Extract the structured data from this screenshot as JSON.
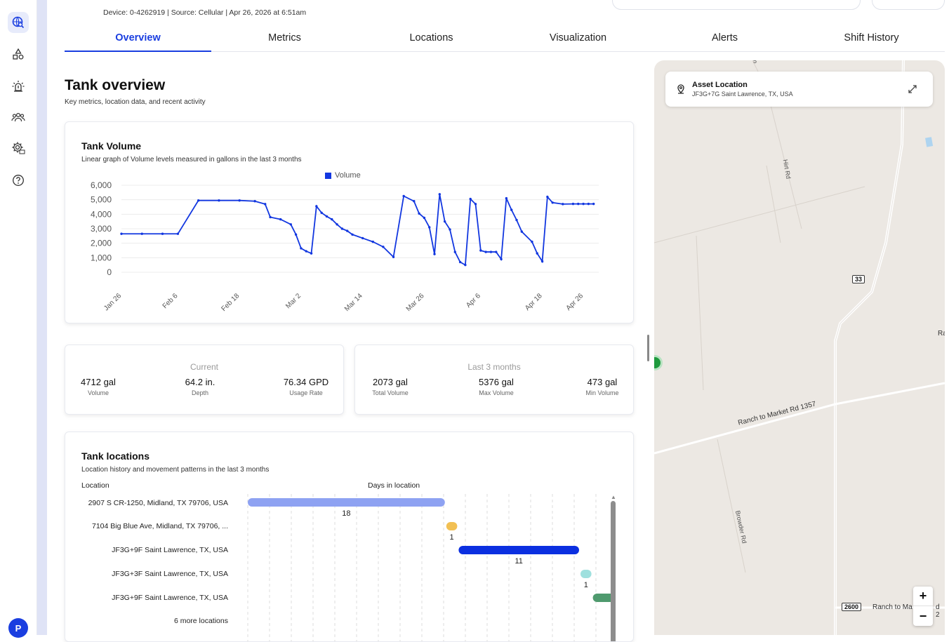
{
  "header": {
    "device_line": "Device: 0-4262919  |  Source: Cellular  |  Apr 26, 2026 at 6:51am"
  },
  "tabs": [
    "Overview",
    "Metrics",
    "Locations",
    "Visualization",
    "Alerts",
    "Shift History"
  ],
  "page": {
    "title": "Tank overview",
    "subtitle": "Key metrics, location data, and recent activity"
  },
  "volume_card": {
    "title": "Tank Volume",
    "subtitle": "Linear graph of Volume levels measured in gallons in the last 3 months",
    "legend": "Volume"
  },
  "chart_data": {
    "type": "line",
    "title": "Tank Volume",
    "ylim": [
      0,
      6000
    ],
    "y_ticks": [
      "6,000",
      "5,000",
      "4,000",
      "3,000",
      "2,000",
      "1,000",
      "0"
    ],
    "x_ticks": [
      "Jan 26",
      "Feb 6",
      "Feb 18",
      "Mar 2",
      "Mar 14",
      "Mar 26",
      "Apr 6",
      "Apr 18",
      "Apr 26"
    ],
    "x_range": [
      "Jan 26",
      "Apr 29"
    ],
    "series": [
      {
        "name": "Volume",
        "color": "#1237e0",
        "x": [
          "Jan 26",
          "Jan 30",
          "Feb 3",
          "Feb 6",
          "Feb 10",
          "Feb 14",
          "Feb 18",
          "Feb 21",
          "Feb 23",
          "Feb 24",
          "Feb 26",
          "Feb 28",
          "Mar 1",
          "Mar 2",
          "Mar 3",
          "Mar 4",
          "Mar 5",
          "Mar 6",
          "Mar 7",
          "Mar 8",
          "Mar 9",
          "Mar 10",
          "Mar 11",
          "Mar 12",
          "Mar 14",
          "Mar 16",
          "Mar 18",
          "Mar 20",
          "Mar 22",
          "Mar 24",
          "Mar 25",
          "Mar 26",
          "Mar 27",
          "Mar 28",
          "Mar 29",
          "Mar 30",
          "Mar 31",
          "Apr 1",
          "Apr 2",
          "Apr 3",
          "Apr 4",
          "Apr 5",
          "Apr 6",
          "Apr 7",
          "Apr 8",
          "Apr 9",
          "Apr 10",
          "Apr 11",
          "Apr 12",
          "Apr 13",
          "Apr 14",
          "Apr 16",
          "Apr 17",
          "Apr 18",
          "Apr 19",
          "Apr 20",
          "Apr 22",
          "Apr 24",
          "Apr 25",
          "Apr 26",
          "Apr 27",
          "Apr 28"
        ],
        "values": [
          2650,
          2650,
          2650,
          2650,
          4950,
          4950,
          4950,
          4900,
          4700,
          3800,
          3650,
          3300,
          2600,
          1650,
          1450,
          1300,
          4550,
          4100,
          3850,
          3650,
          3300,
          3000,
          2850,
          2600,
          2350,
          2100,
          1750,
          1050,
          5250,
          4900,
          4050,
          3750,
          3100,
          1250,
          5380,
          3500,
          2950,
          1400,
          700,
          500,
          5050,
          4700,
          1500,
          1400,
          1400,
          1400,
          900,
          5100,
          4300,
          3600,
          2800,
          2100,
          1300,
          750,
          5200,
          4800,
          4700,
          4712,
          4712,
          4712,
          4712,
          4712
        ]
      }
    ]
  },
  "current_card": {
    "heading": "Current",
    "stats": [
      {
        "value": "4712 gal",
        "label": "Volume"
      },
      {
        "value": "64.2 in.",
        "label": "Depth"
      },
      {
        "value": "76.34 GPD",
        "label": "Usage Rate"
      }
    ]
  },
  "last3_card": {
    "heading": "Last 3 months",
    "stats": [
      {
        "value": "2073 gal",
        "label": "Total Volume"
      },
      {
        "value": "5376 gal",
        "label": "Max Volume"
      },
      {
        "value": "473 gal",
        "label": "Min Volume"
      }
    ]
  },
  "locations_card": {
    "title": "Tank locations",
    "subtitle": "Location history and movement patterns in the last 3 months",
    "col_location": "Location",
    "col_days": "Days in location",
    "rows": [
      {
        "name": "2907 S CR-1250, Midland, TX 79706, USA",
        "days": 18,
        "days_label": "18",
        "color": "#8ea2f2"
      },
      {
        "name": "7104 Big Blue Ave, Midland, TX 79706, ...",
        "days": 1,
        "days_label": "1",
        "color": "#f2c053"
      },
      {
        "name": "JF3G+9F Saint Lawrence, TX, USA",
        "days": 11,
        "days_label": "11",
        "color": "#0b2fe0"
      },
      {
        "name": "JF3G+3F Saint Lawrence, TX, USA",
        "days": 1,
        "days_label": "1",
        "color": "#9fe0de"
      },
      {
        "name": "JF3G+9F Saint Lawrence, TX, USA",
        "days": 2,
        "days_label": "",
        "color": "#4f9a6e"
      }
    ],
    "more": "6 more locations"
  },
  "map": {
    "asset_title": "Asset Location",
    "asset_address": "JF3G+7G Saint Lawrence, TX, USA",
    "road_hirt": "Hirt Rd",
    "road_rm1357": "Ranch to Market Rd 1357",
    "road_browder": "Browder Rd",
    "shield_33": "33",
    "shield_2600": "2600",
    "road_bottom": "Ranch to Ma",
    "road_bottom2": "d 2",
    "edge_label": "Ra",
    "top_label": "5",
    "zoom_in": "+",
    "zoom_out": "−"
  },
  "user": {
    "initial": "P"
  }
}
